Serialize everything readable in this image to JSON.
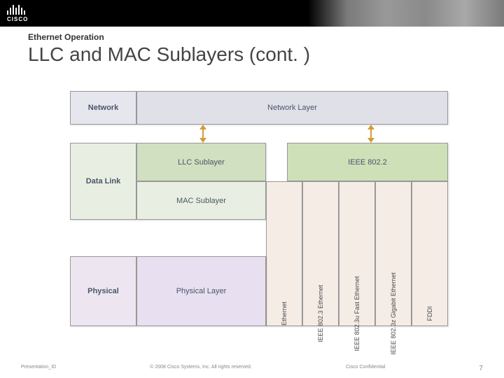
{
  "banner": {
    "logo_label": "CISCO"
  },
  "header": {
    "kicker": "Ethernet Operation",
    "title": "LLC and MAC Sublayers (cont. )"
  },
  "diagram": {
    "network": {
      "label": "Network",
      "right": "Network Layer"
    },
    "datalink": {
      "label": "Data Link",
      "llc": "LLC Sublayer",
      "ieee": "IEEE 802.2",
      "mac": "MAC Sublayer"
    },
    "columns": [
      "Ethernet",
      "IEEE 802.3 Ethernet",
      "IEEE 802.3u Fast Ethernet",
      "IEEE 802.3z Gigabit Ethernet",
      "FDDI"
    ],
    "physical": {
      "label": "Physical",
      "right": "Physical Layer"
    }
  },
  "footer": {
    "left": "Presentation_ID",
    "center": "© 2008 Cisco Systems, Inc. All rights reserved.",
    "right": "Cisco Confidential",
    "page": "7"
  }
}
